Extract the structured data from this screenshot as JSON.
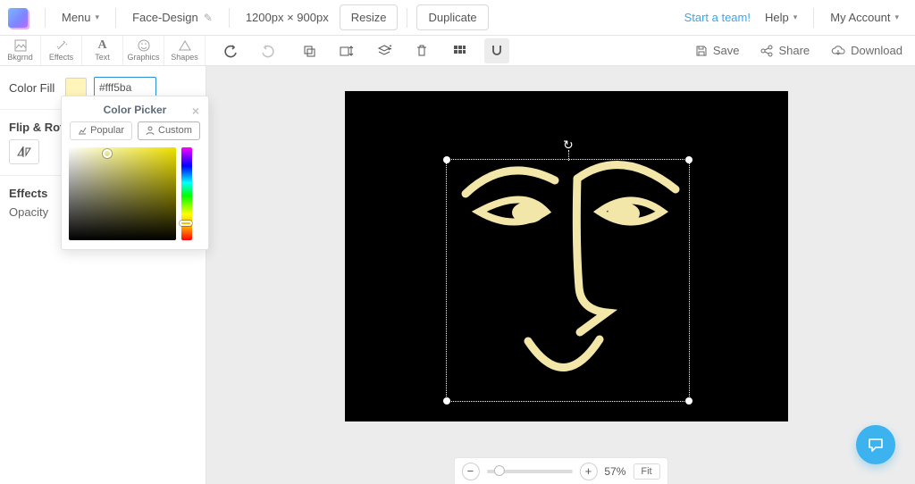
{
  "topbar": {
    "menu_label": "Menu",
    "design_name": "Face-Design",
    "dimensions": "1200px × 900px",
    "resize": "Resize",
    "duplicate": "Duplicate",
    "start_team": "Start a team!",
    "help": "Help",
    "account": "My Account"
  },
  "tooltabs": {
    "bkgrnd": "Bkgrnd",
    "effects": "Effects",
    "text": "Text",
    "graphics": "Graphics",
    "shapes": "Shapes"
  },
  "canvasbar": {
    "save": "Save",
    "share": "Share",
    "download": "Download"
  },
  "side": {
    "color_fill": "Color Fill",
    "hex_value": "#fff5ba",
    "flip_rotate": "Flip & Rota",
    "effects": "Effects",
    "opacity": "Opacity"
  },
  "picker": {
    "title": "Color Picker",
    "popular": "Popular",
    "custom": "Custom",
    "base_hue": "#eee100",
    "selected": "#fff5ba"
  },
  "zoom": {
    "percent": "57%",
    "fit": "Fit"
  },
  "colors": {
    "face_stroke": "#f2e6a9",
    "canvas_bg": "#000000"
  }
}
